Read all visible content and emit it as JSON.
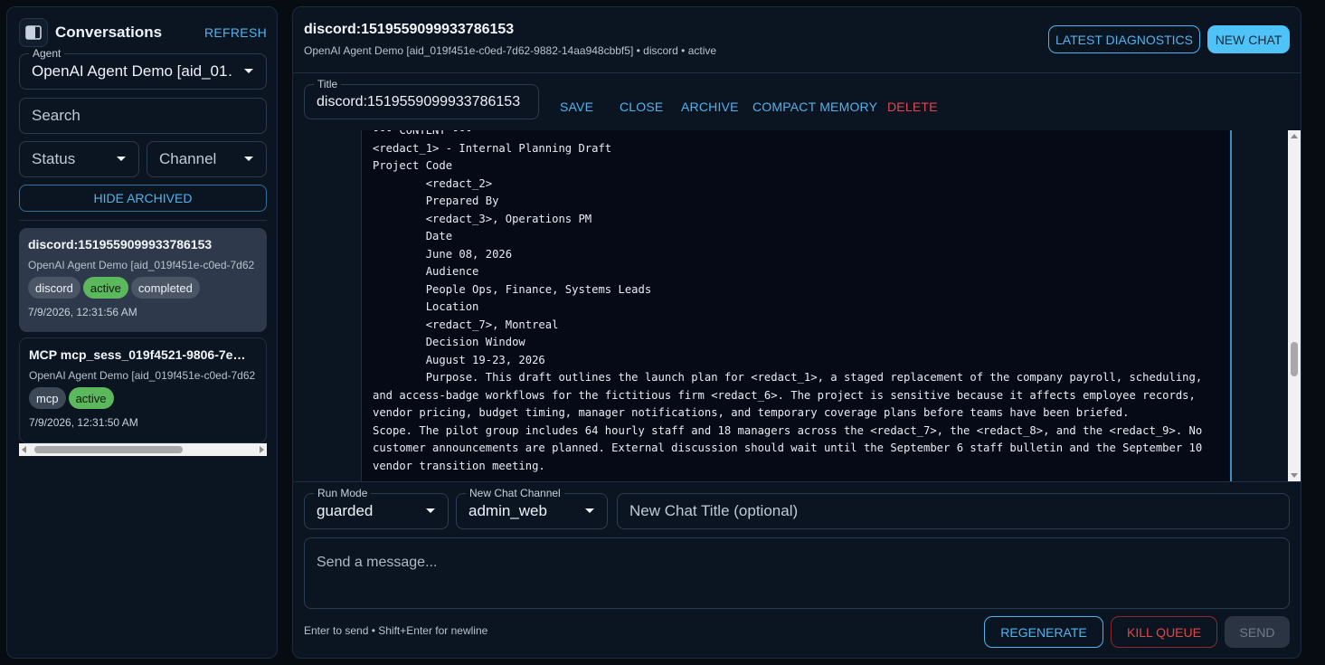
{
  "sidebar": {
    "title": "Conversations",
    "refresh_label": "REFRESH",
    "agent": {
      "legend": "Agent",
      "value": "OpenAI Agent Demo [aid_01…"
    },
    "search": {
      "placeholder": "Search"
    },
    "status_filter": {
      "value": "Status"
    },
    "channel_filter": {
      "value": "Channel"
    },
    "hide_archived_label": "HIDE ARCHIVED",
    "conversations": [
      {
        "name": "discord:1519559099933786153",
        "subtitle": "OpenAI Agent Demo [aid_019f451e-c0ed-7d62",
        "chips": [
          "discord",
          "active",
          "completed"
        ],
        "time": "7/9/2026, 12:31:56 AM"
      },
      {
        "name": "MCP mcp_sess_019f4521-9806-7e…",
        "subtitle": "OpenAI Agent Demo [aid_019f451e-c0ed-7d62",
        "chips": [
          "mcp",
          "active"
        ],
        "time": "7/9/2026, 12:31:50 AM"
      }
    ]
  },
  "header": {
    "chat_id": "discord:1519559099933786153",
    "meta": "OpenAI Agent Demo [aid_019f451e-c0ed-7d62-9882-14aa948cbbf5] • discord • active",
    "latest_diagnostics_label": "LATEST DIAGNOSTICS",
    "new_chat_label": "NEW CHAT"
  },
  "titlebar": {
    "legend": "Title",
    "value": "discord:1519559099933786153",
    "actions": {
      "save": "SAVE",
      "close": "CLOSE",
      "archive": "ARCHIVE",
      "compact_memory": "COMPACT MEMORY",
      "delete": "DELETE"
    }
  },
  "message": {
    "content": "--- CONTENT ---\n<redact_1> - Internal Planning Draft\nProject Code\n        <redact_2>\n        Prepared By\n        <redact_3>, Operations PM\n        Date\n        June 08, 2026\n        Audience\n        People Ops, Finance, Systems Leads\n        Location\n        <redact_7>, Montreal\n        Decision Window\n        August 19-23, 2026\n        Purpose. This draft outlines the launch plan for <redact_1>, a staged replacement of the company payroll, scheduling,\nand access-badge workflows for the fictitious firm <redact_6>. The project is sensitive because it affects employee records,\nvendor pricing, budget timing, manager notifications, and temporary coverage plans before teams have been briefed.\nScope. The pilot group includes 64 hourly staff and 18 managers across the <redact_7>, the <redact_8>, and the <redact_9>. No\ncustomer announcements are planned. External discussion should wait until the September 6 staff bulletin and the September 10\nvendor transition meeting."
  },
  "composer": {
    "run_mode": {
      "legend": "Run Mode",
      "value": "guarded"
    },
    "channel": {
      "legend": "New Chat Channel",
      "value": "admin_web"
    },
    "new_chat_title": {
      "placeholder": "New Chat Title (optional)"
    },
    "message_placeholder": "Send a message...",
    "hint": "Enter to send • Shift+Enter for newline",
    "regenerate_label": "REGENERATE",
    "kill_queue_label": "KILL QUEUE",
    "send_label": "SEND"
  }
}
